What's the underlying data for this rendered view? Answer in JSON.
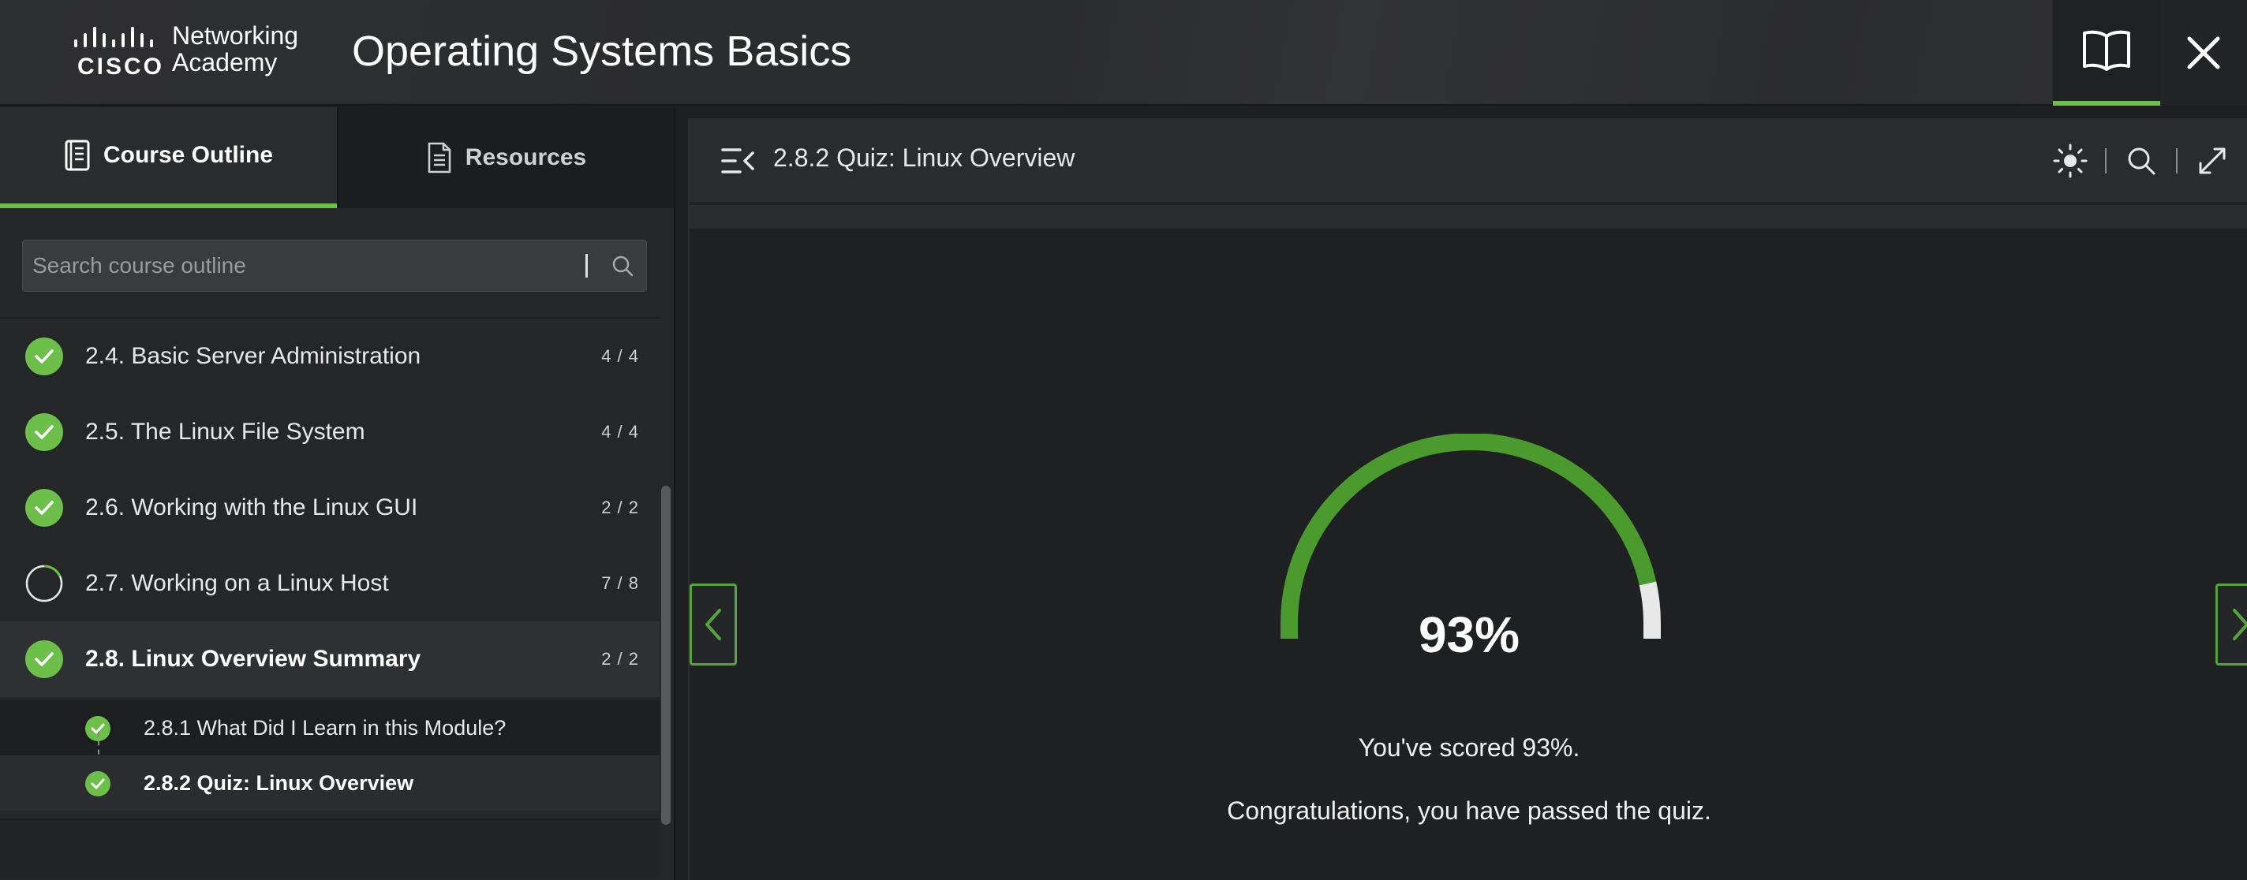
{
  "header": {
    "brand_line1": "Networking",
    "brand_line2": "Academy",
    "brand_logo": "cisco",
    "title": "Operating Systems Basics",
    "icons": {
      "book": "book-open-icon",
      "close": "close-icon"
    }
  },
  "sidebar": {
    "tabs": [
      {
        "label": "Course Outline",
        "icon": "outline-book-icon",
        "active": true
      },
      {
        "label": "Resources",
        "icon": "document-icon",
        "active": false
      }
    ],
    "search": {
      "placeholder": "Search course outline",
      "value": ""
    },
    "items": [
      {
        "label": "2.4. Basic Server Administration",
        "count": "4 / 4",
        "status": "complete"
      },
      {
        "label": "2.5. The Linux File System",
        "count": "4 / 4",
        "status": "complete"
      },
      {
        "label": "2.6. Working with the Linux GUI",
        "count": "2 / 2",
        "status": "complete"
      },
      {
        "label": "2.7. Working on a Linux Host",
        "count": "7 / 8",
        "status": "in-progress"
      },
      {
        "label": "2.8. Linux Overview Summary",
        "count": "2 / 2",
        "status": "complete"
      }
    ],
    "subitems": [
      {
        "label": "2.8.1 What Did I Learn in this Module?",
        "status": "complete"
      },
      {
        "label": "2.8.2 Quiz: Linux Overview",
        "status": "complete"
      }
    ]
  },
  "content": {
    "title": "2.8.2 Quiz: Linux Overview",
    "score_text": "93%",
    "score_fraction": 0.93,
    "message_score": "You've scored 93%.",
    "message_pass": "Congratulations, you have passed the quiz."
  },
  "colors": {
    "accent_green": "#6cc04a",
    "gauge_green": "#4a9a2d",
    "gauge_remainder": "#e8e8e8"
  }
}
